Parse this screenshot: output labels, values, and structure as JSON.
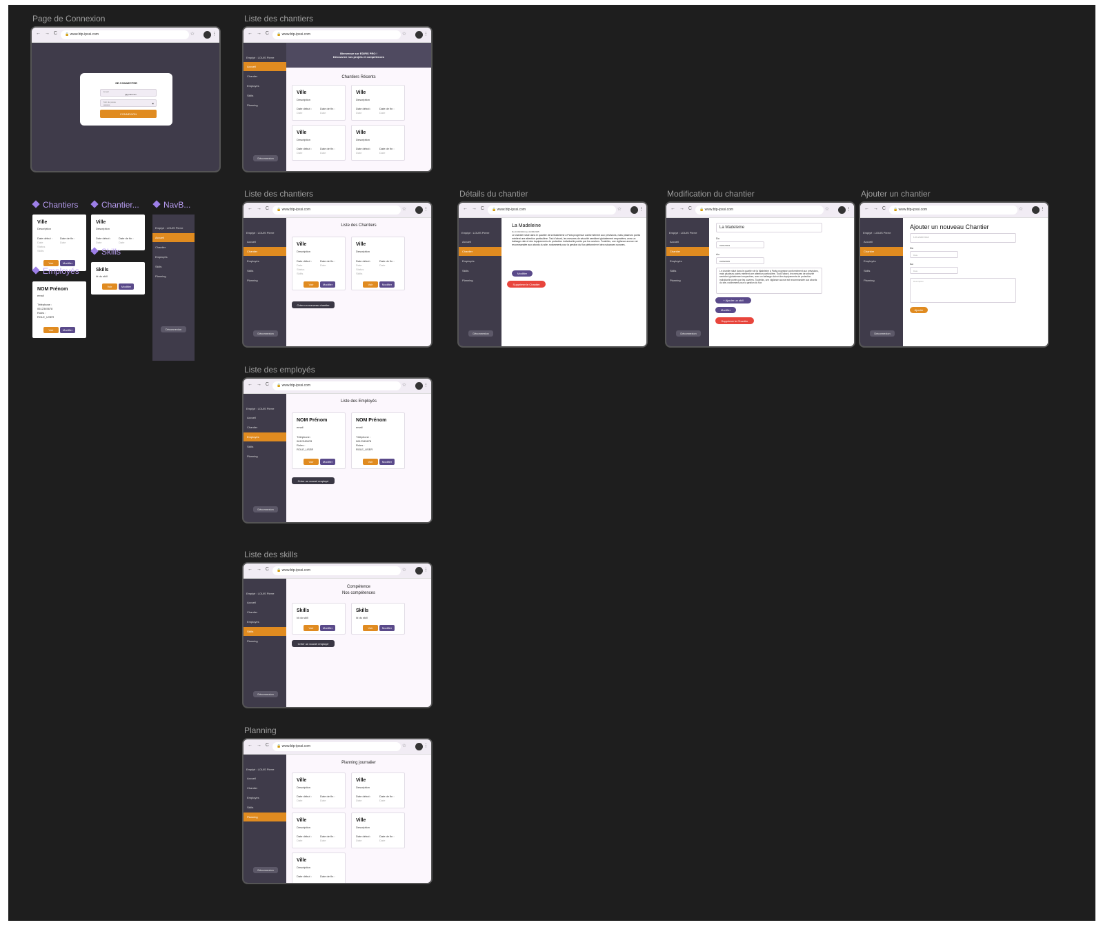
{
  "browser": {
    "url": "www.btp-ipssi.com"
  },
  "frames": {
    "login": "Page de Connexion",
    "accueil": "Liste des chantiers",
    "chantiers": "Liste des chantiers",
    "details": "Détails du chantier",
    "modification": "Modification du chantier",
    "ajouter": "Ajouter un chantier",
    "employes": "Liste des employés",
    "skills": "Liste des skills",
    "planning": "Planning"
  },
  "components": {
    "chantiers": "Chantiers",
    "chantier2": "Chantier...",
    "navbar": "NavB...",
    "skills": "Skills",
    "employes": "Employés"
  },
  "sidebar": {
    "user": "Emplyé : LOUIS Pierre",
    "items": [
      "Accueil",
      "Chantier",
      "Employés",
      "Skills",
      "Planning"
    ],
    "logout": "Déconnexion"
  },
  "login": {
    "title": "SE CONNECTER",
    "email_label": "Email",
    "email_value": "@gmail.com",
    "password_label": "Mot de passe",
    "password_value": "•••••••••",
    "submit": "CONNEXION"
  },
  "accueil": {
    "banner_line1": "Bienvenue sur EDIFIS PRO !",
    "banner_line2": "Découvrez nos projets et compétences",
    "section_title": "Chantiers Récents"
  },
  "chantier_card": {
    "title": "Ville",
    "description": "Description",
    "date_debut": "Date début :",
    "date_fin": "Date de fin :",
    "date_value": "Date",
    "statut": "Status",
    "skills": "Skills",
    "voir": "Voir",
    "modifier": "Modifier"
  },
  "chantiers_page": {
    "title": "Liste des Chantiers",
    "create": "Créer un nouveau chantier"
  },
  "details": {
    "title": "La Madeleine",
    "dates": "Du 01/01/2024 au 01/06/2025",
    "text": "Le chantier situé dans le quartier de la Madeleine à Paris progresse conformément aux prévisions, mais plusieurs points méritent une attention particulière. Tout d'abord, les mesures de sécurité semblent globalement respectées, avec un balisage clair et des équipements de protection individuelle portés par les ouvriers. Toutefois, une vigilance accrue est recommandée aux abords du site, notamment pour la gestion du flux piétonnier et des nuisances sonores.",
    "modifier": "Modifier",
    "supprimer": "Supprimer le Chantier"
  },
  "modification": {
    "name": "La Madeleine",
    "du_label": "Du",
    "du_value": "01/01/2024",
    "au_label": "Au",
    "au_value": "01/06/2025",
    "text": "Le chantier situé dans le quartier de la Madeleine à Paris progresse conformément aux prévisions, mais plusieurs points méritent une attention particulière. Tout d'abord, les mesures de sécurité semblent globalement respectées, avec un balisage clair et des équipements de protection individuelle portés par les ouvriers. Toutefois, une vigilance accrue est recommandée aux abords du site, notamment pour la gestion du flux",
    "add_skill": "+ Ajouter un skill",
    "modifier": "Modifier",
    "supprimer": "Supprimer le Chantier"
  },
  "ajouter": {
    "title": "Ajouter un nouveau Chantier",
    "name_placeholder": "Lieu/adresse",
    "du_label": "Du",
    "au_label": "Au",
    "date_placeholder": "Date",
    "desc_placeholder": "Description",
    "submit": "Ajouter"
  },
  "employes": {
    "title": "Liste des Employés",
    "card_name": "NOM Prénom",
    "card_email": "email",
    "card_tel_label": "Téléphone :",
    "card_tel": "0612345678",
    "card_roles_label": "Roles :",
    "card_role": "ROLE_USER",
    "create": "Créer un nouvel employé"
  },
  "skills": {
    "title_line1": "Compétence",
    "title_line2": "Nos compétences",
    "card_title": "Skills",
    "card_sub": "Id du skill",
    "create": "Créer un nouvel employé"
  },
  "planning": {
    "title": "Planning journalier"
  }
}
